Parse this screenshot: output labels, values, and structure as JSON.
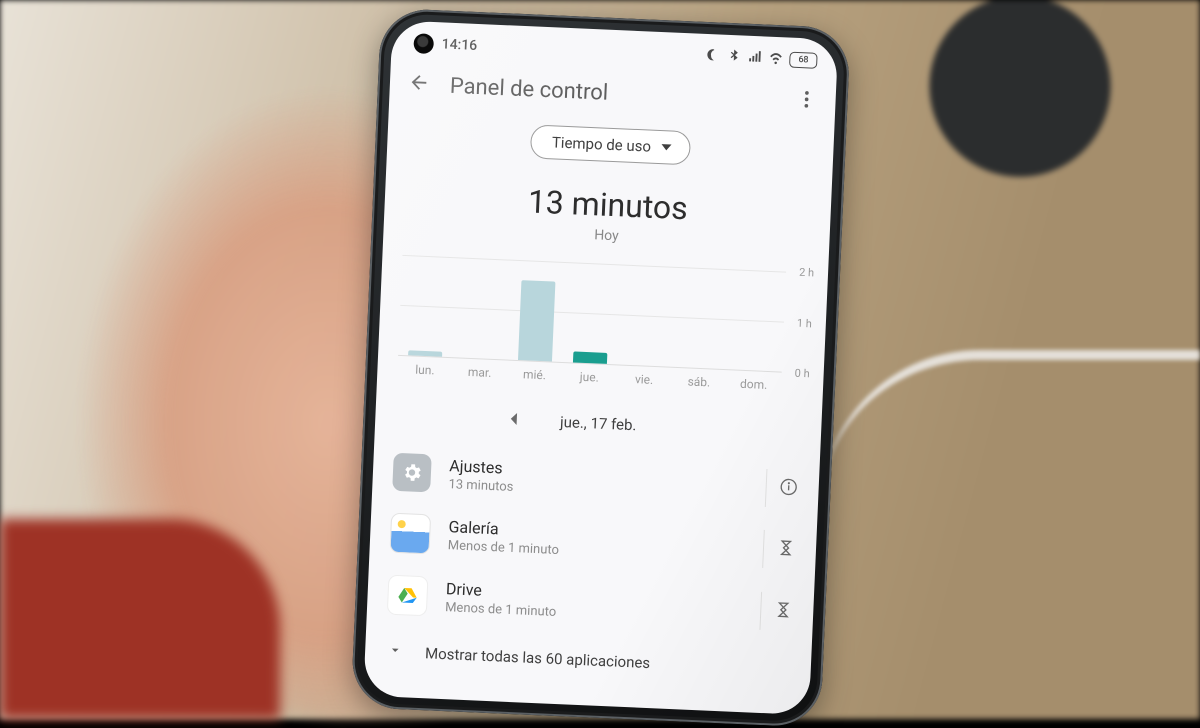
{
  "status_bar": {
    "time": "14:16",
    "battery_text": "68",
    "icons": [
      "dnd",
      "bluetooth",
      "signal",
      "wifi",
      "battery"
    ]
  },
  "header": {
    "title": "Panel de control"
  },
  "metric_selector": {
    "label": "Tiempo de uso"
  },
  "headline": {
    "value": "13 minutos",
    "period": "Hoy"
  },
  "date_nav": {
    "label": "jue., 17 feb."
  },
  "apps": [
    {
      "name": "Ajustes",
      "time": "13 minutos",
      "icon": "settings",
      "trailing": "info"
    },
    {
      "name": "Galería",
      "time": "Menos de 1 minuto",
      "icon": "gallery",
      "trailing": "timer"
    },
    {
      "name": "Drive",
      "time": "Menos de 1 minuto",
      "icon": "drive",
      "trailing": "timer"
    }
  ],
  "expand": {
    "label": "Mostrar todas las 60 aplicaciones"
  },
  "chart_data": {
    "type": "bar",
    "title": "",
    "xlabel": "",
    "ylabel": "",
    "ylim": [
      0,
      2
    ],
    "yticks": [
      0,
      1,
      2
    ],
    "ytick_labels": [
      "0 h",
      "1 h",
      "2 h"
    ],
    "unit": "hours",
    "categories": [
      "lun.",
      "mar.",
      "mié.",
      "jue.",
      "vie.",
      "sáb.",
      "dom."
    ],
    "values": [
      0.1,
      0.0,
      1.6,
      0.22,
      0.0,
      0.0,
      0.0
    ],
    "selected_index": 3,
    "colors": {
      "default": "#b8d6dc",
      "selected": "#1a9e8f"
    }
  }
}
